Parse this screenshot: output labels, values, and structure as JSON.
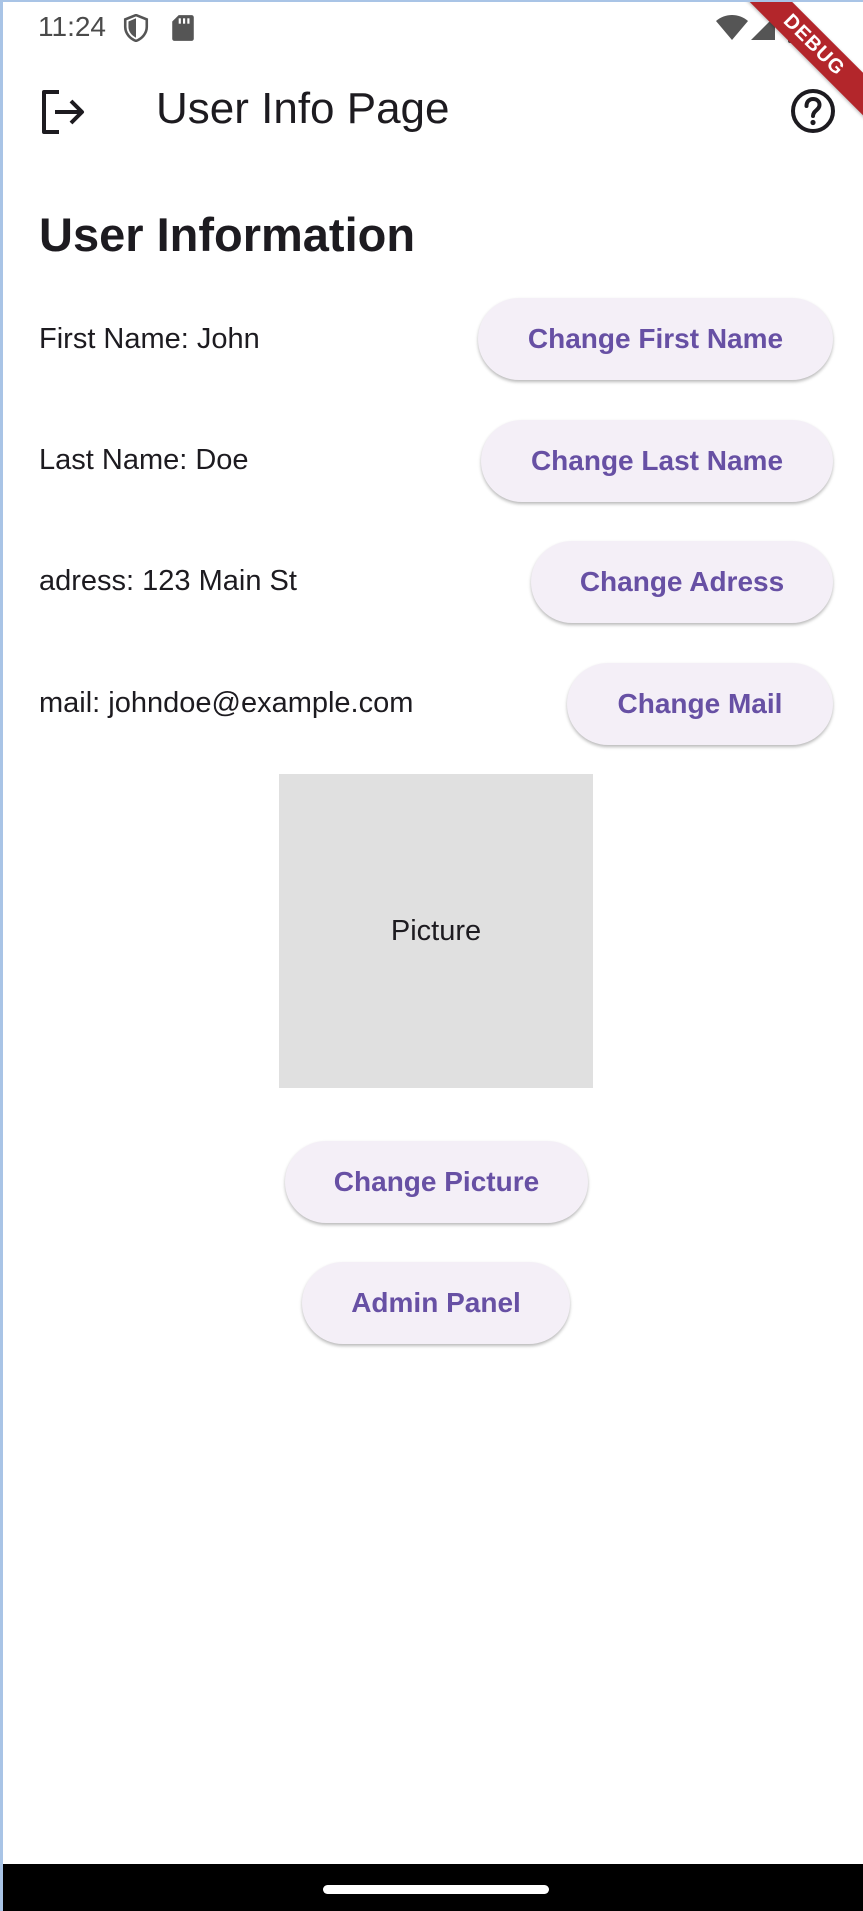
{
  "status_bar": {
    "time": "11:24",
    "icons": [
      "shield-icon",
      "sd-card-icon",
      "wifi-icon",
      "cellular-signal-icon",
      "battery-icon"
    ]
  },
  "debug_banner": "DEBUG",
  "app_bar": {
    "title": "User Info Page",
    "leading_icon": "logout-icon",
    "trailing_icon": "help-icon"
  },
  "content": {
    "heading": "User Information",
    "fields": [
      {
        "label": "First Name: John",
        "button": "Change First Name"
      },
      {
        "label": "Last Name: Doe",
        "button": "Change Last Name"
      },
      {
        "label": "adress: 123 Main St",
        "button": "Change Adress"
      },
      {
        "label": "mail: johndoe@example.com",
        "button": "Change Mail"
      }
    ],
    "picture_label": "Picture",
    "change_picture_button": "Change Picture",
    "admin_panel_button": "Admin Panel"
  },
  "colors": {
    "accent": "#6750a4",
    "button_bg": "#f4eff7",
    "picture_bg": "#e0e0e0",
    "debug_banner": "#b3262b"
  }
}
